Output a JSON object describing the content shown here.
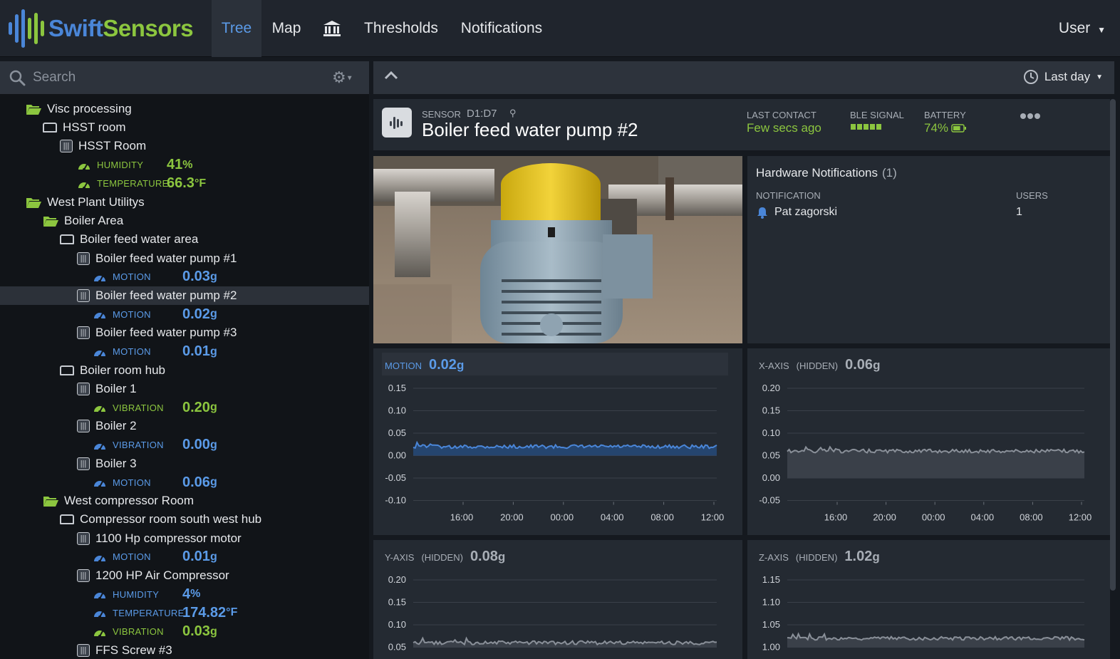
{
  "brand": {
    "name_part1": "Swift",
    "name_part2": "Sensors",
    "colors": {
      "blue": "#4a86d8",
      "green": "#8cc63f"
    }
  },
  "nav": {
    "tabs": [
      {
        "label": "Tree",
        "active": true
      },
      {
        "label": "Map"
      },
      {
        "icon": "bank-icon"
      },
      {
        "label": "Thresholds"
      },
      {
        "label": "Notifications"
      }
    ],
    "user": "User"
  },
  "sidebar": {
    "search_placeholder": "Search",
    "tree": [
      {
        "type": "folder",
        "label": "Visc processing"
      },
      {
        "type": "hub",
        "label": "HSST room"
      },
      {
        "type": "sensor",
        "label": "HSST Room"
      },
      {
        "type": "metric",
        "label": "HUMIDITY",
        "value": "41",
        "unit": "%",
        "color": "green"
      },
      {
        "type": "metric",
        "label": "TEMPERATURE",
        "value": "66.3",
        "unit": "°F",
        "color": "green"
      },
      {
        "type": "folder",
        "label": "West Plant Utilitys"
      },
      {
        "type": "folder",
        "label": "Boiler Area"
      },
      {
        "type": "hub",
        "label": "Boiler feed water area"
      },
      {
        "type": "sensor",
        "label": "Boiler feed water pump #1"
      },
      {
        "type": "metric",
        "label": "MOTION",
        "value": "0.03",
        "unit": "g",
        "color": "blue"
      },
      {
        "type": "sensor",
        "label": "Boiler feed water pump #2",
        "selected": true
      },
      {
        "type": "metric",
        "label": "MOTION",
        "value": "0.02",
        "unit": "g",
        "color": "blue"
      },
      {
        "type": "sensor",
        "label": "Boiler feed water pump #3"
      },
      {
        "type": "metric",
        "label": "MOTION",
        "value": "0.01",
        "unit": "g",
        "color": "blue"
      },
      {
        "type": "hub",
        "label": "Boiler room hub"
      },
      {
        "type": "sensor",
        "label": "Boiler 1"
      },
      {
        "type": "metric",
        "label": "VIBRATION",
        "value": "0.20",
        "unit": "g",
        "color": "green"
      },
      {
        "type": "sensor",
        "label": "Boiler 2"
      },
      {
        "type": "metric",
        "label": "VIBRATION",
        "value": "0.00",
        "unit": "g",
        "color": "blue"
      },
      {
        "type": "sensor",
        "label": "Boiler 3"
      },
      {
        "type": "metric",
        "label": "MOTION",
        "value": "0.06",
        "unit": "g",
        "color": "blue"
      },
      {
        "type": "folder",
        "label": "West compressor Room"
      },
      {
        "type": "hub",
        "label": "Compressor room south west hub"
      },
      {
        "type": "sensor",
        "label": "1100 Hp compressor motor"
      },
      {
        "type": "metric",
        "label": "MOTION",
        "value": "0.01",
        "unit": "g",
        "color": "blue"
      },
      {
        "type": "sensor",
        "label": "1200 HP Air Compressor"
      },
      {
        "type": "metric",
        "label": "HUMIDITY",
        "value": "4",
        "unit": "%",
        "color": "blue"
      },
      {
        "type": "metric",
        "label": "TEMPERATURE",
        "value": "174.82",
        "unit": "°F",
        "color": "blue"
      },
      {
        "type": "metric",
        "label": "VIBRATION",
        "value": "0.03",
        "unit": "g",
        "color": "green"
      },
      {
        "type": "sensor",
        "label": "FFS Screw #3"
      }
    ]
  },
  "toolbar": {
    "time_range": "Last day"
  },
  "sensor": {
    "kind_label": "SENSOR",
    "id": "D1:D7",
    "title": "Boiler feed water pump #2",
    "last_contact_label": "LAST CONTACT",
    "last_contact_value": "Few secs ago",
    "ble_label": "BLE SIGNAL",
    "ble_bars": 5,
    "battery_label": "BATTERY",
    "battery_value": "74%",
    "battery_fraction": 0.74
  },
  "notifications": {
    "title": "Hardware Notifications",
    "count": "(1)",
    "col_notification": "NOTIFICATION",
    "col_users": "USERS",
    "rows": [
      {
        "name": "Pat zagorski",
        "users": "1"
      }
    ]
  },
  "chart_data": [
    {
      "type": "area",
      "label": "MOTION",
      "value": "0.02",
      "unit": "g",
      "color": "#4a86d8",
      "highlight": true,
      "yticks": [
        "0.15",
        "0.10",
        "0.05",
        "0.00",
        "-0.05",
        "-0.10"
      ],
      "ylim": [
        -0.1,
        0.15
      ],
      "xticks": [
        "16:00",
        "20:00",
        "00:00",
        "04:00",
        "08:00",
        "12:00"
      ],
      "baseline": 0.0,
      "level": 0.02
    },
    {
      "type": "area",
      "label": "X-AXIS",
      "qualifier": "(HIDDEN)",
      "value": "0.06",
      "unit": "g",
      "color": "#8a9099",
      "yticks": [
        "0.20",
        "0.15",
        "0.10",
        "0.05",
        "0.00",
        "-0.05"
      ],
      "ylim": [
        -0.05,
        0.2
      ],
      "xticks": [
        "16:00",
        "20:00",
        "00:00",
        "04:00",
        "08:00",
        "12:00"
      ],
      "baseline": 0.0,
      "level": 0.06
    },
    {
      "type": "area",
      "label": "Y-AXIS",
      "qualifier": "(HIDDEN)",
      "value": "0.08",
      "unit": "g",
      "color": "#8a9099",
      "yticks": [
        "0.20",
        "0.15",
        "0.10",
        "0.05"
      ],
      "ylim": [
        0.05,
        0.2
      ],
      "xticks": [],
      "baseline": 0.05,
      "level": 0.06
    },
    {
      "type": "area",
      "label": "Z-AXIS",
      "qualifier": "(HIDDEN)",
      "value": "1.02",
      "unit": "g",
      "color": "#8a9099",
      "yticks": [
        "1.15",
        "1.10",
        "1.05",
        "1.00"
      ],
      "ylim": [
        1.0,
        1.15
      ],
      "xticks": [],
      "baseline": 1.0,
      "level": 1.02
    }
  ]
}
